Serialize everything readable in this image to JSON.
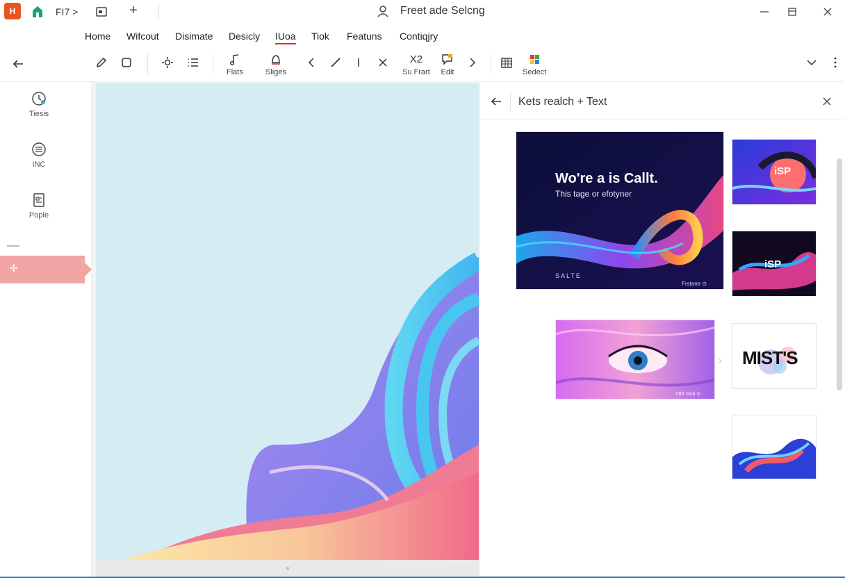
{
  "titlebar": {
    "app_logo": "H",
    "tab_label": "FI7 >",
    "doc_title": "Freet ade Selcng",
    "icons": [
      "home-icon",
      "window-icon",
      "plus-icon",
      "user-icon",
      "minimize-icon",
      "restore-icon",
      "close-icon"
    ]
  },
  "menu": {
    "items": [
      "Home",
      "Wifcout",
      "Disimate",
      "Desicly",
      "IUoa",
      "Tiok",
      "Featuns",
      "Contiqjry"
    ],
    "active_index": 4
  },
  "toolbar": {
    "flats_label": "Flats",
    "sliges_label": "Sliges",
    "x2_label": "X2",
    "suprart_label": "Su Frart",
    "edit_label": "Edit",
    "sedect_label": "Sedect",
    "badge_count": "1"
  },
  "leftrail": {
    "items": [
      {
        "label": "Tiesis",
        "icon": "clock-icon"
      },
      {
        "label": "INC",
        "icon": "list-circle-icon"
      },
      {
        "label": "Pople",
        "icon": "document-icon"
      }
    ],
    "active_glyph": "✢"
  },
  "panel": {
    "title": "Kets realch + Text",
    "hero": {
      "title": "Wo're a is Callt.",
      "subtitle": "This tage or efotyner",
      "footer_left": "SALTE",
      "footer_right": "Frstane ⊙"
    },
    "thumb_isp_1": "iSP",
    "thumb_isp_2": "iSP",
    "thumb_mists": "MIST'S",
    "eye_footer": "Vttrr mcb ⊙"
  },
  "colors": {
    "accent_red": "#d9342b",
    "app_orange": "#e8541e",
    "active_rail": "#f1a5a5",
    "slide_bg": "#d5ecf3",
    "bottom_accent": "#2f6fe0"
  }
}
